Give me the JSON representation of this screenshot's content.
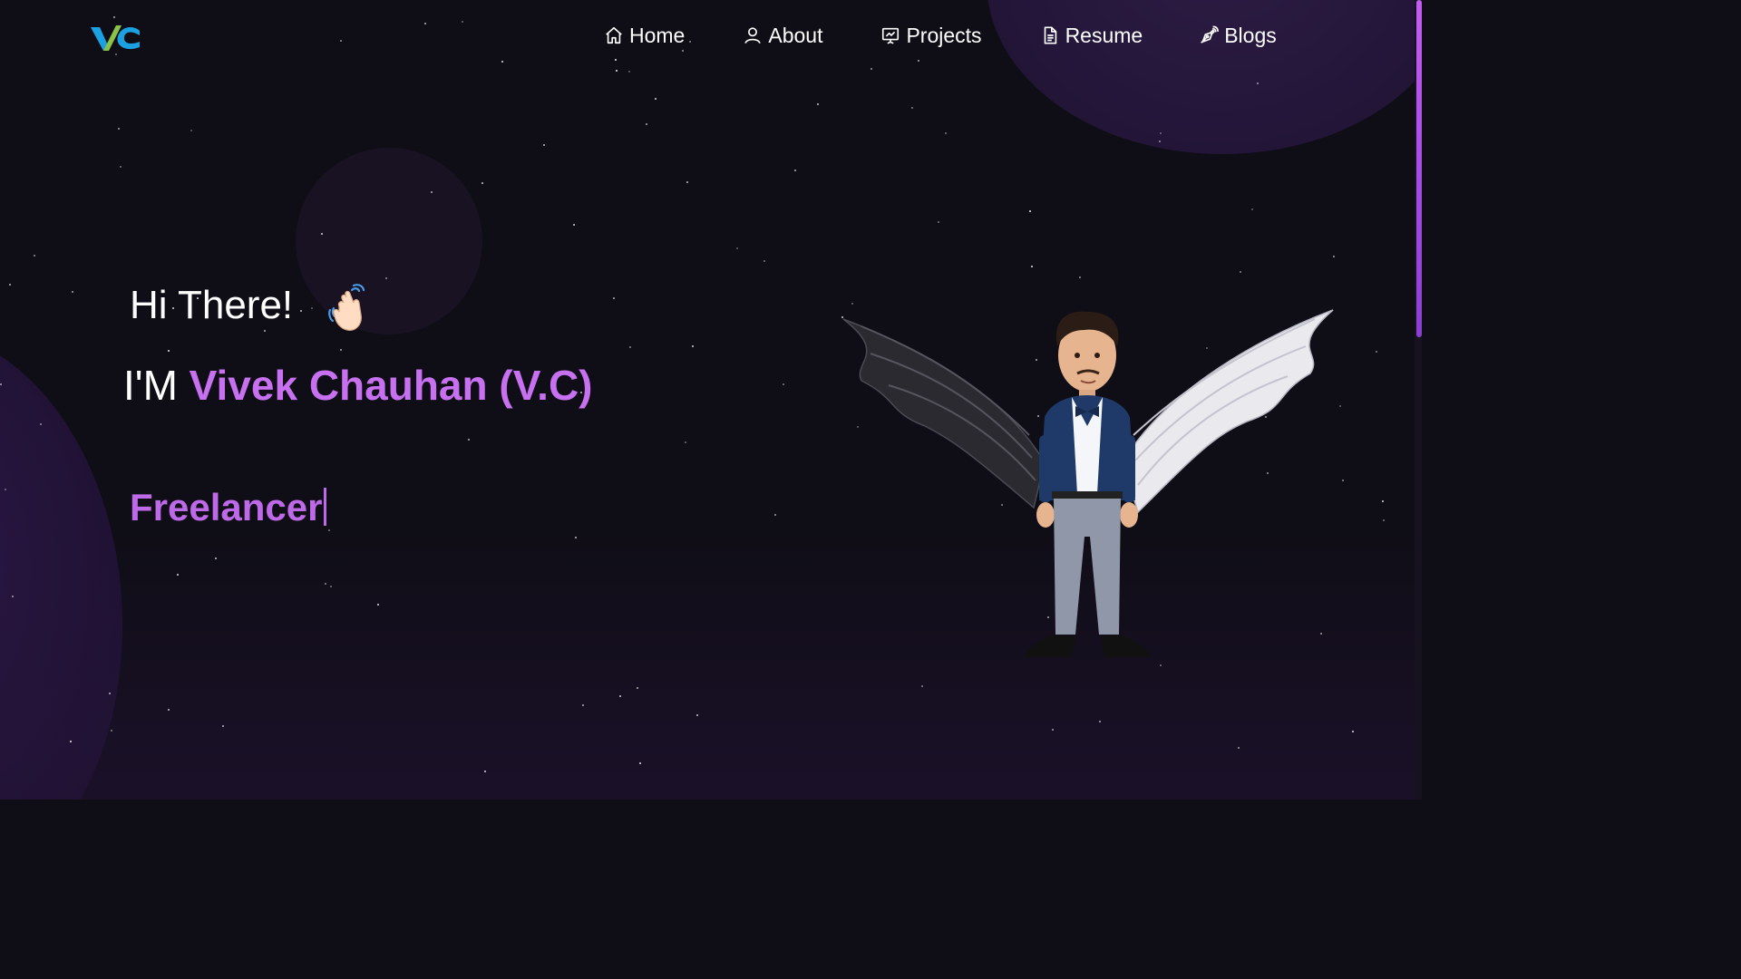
{
  "nav": {
    "logo_text": "VC",
    "items": [
      {
        "label": "Home",
        "icon": "home-icon"
      },
      {
        "label": "About",
        "icon": "user-icon"
      },
      {
        "label": "Projects",
        "icon": "presentation-icon"
      },
      {
        "label": "Resume",
        "icon": "document-icon"
      },
      {
        "label": "Blogs",
        "icon": "pen-nib-icon"
      }
    ]
  },
  "hero": {
    "greeting": "Hi There!",
    "greeting_emoji": "waving-hand-icon",
    "intro_prefix": "I'M",
    "name": "Vivek Chauhan (V.C)",
    "typed_text": "Freelancer"
  },
  "colors": {
    "background": "#0f0d16",
    "accent": "#c770f0",
    "logo_blue": "#1ba1e2",
    "logo_green": "#8bc34a"
  }
}
